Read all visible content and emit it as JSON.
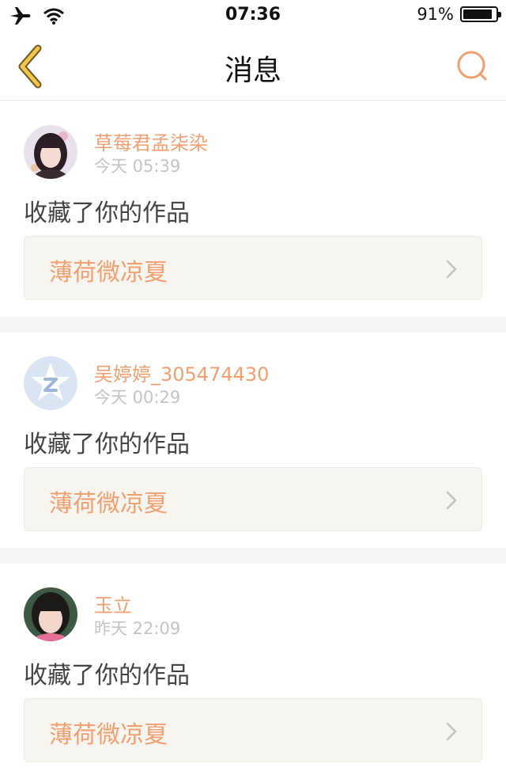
{
  "status": {
    "time": "07:36",
    "battery_percent": "91%",
    "battery_level": 0.91
  },
  "nav": {
    "title": "消息",
    "back_icon": "chevron-left-icon",
    "search_icon": "search-icon"
  },
  "colors": {
    "accent": "#f0a070",
    "back": "#f3c64a",
    "link_bg": "#f6f5f0"
  },
  "messages": [
    {
      "user": "草莓君孟柒染",
      "time": "今天 05:39",
      "action": "收藏了你的作品",
      "work_title": "薄荷微凉夏"
    },
    {
      "user": "吴婷婷_305474430",
      "time": "今天 00:29",
      "action": "收藏了你的作品",
      "work_title": "薄荷微凉夏"
    },
    {
      "user": "玉立",
      "time": "昨天 22:09",
      "action": "收藏了你的作品",
      "work_title": "薄荷微凉夏"
    }
  ]
}
